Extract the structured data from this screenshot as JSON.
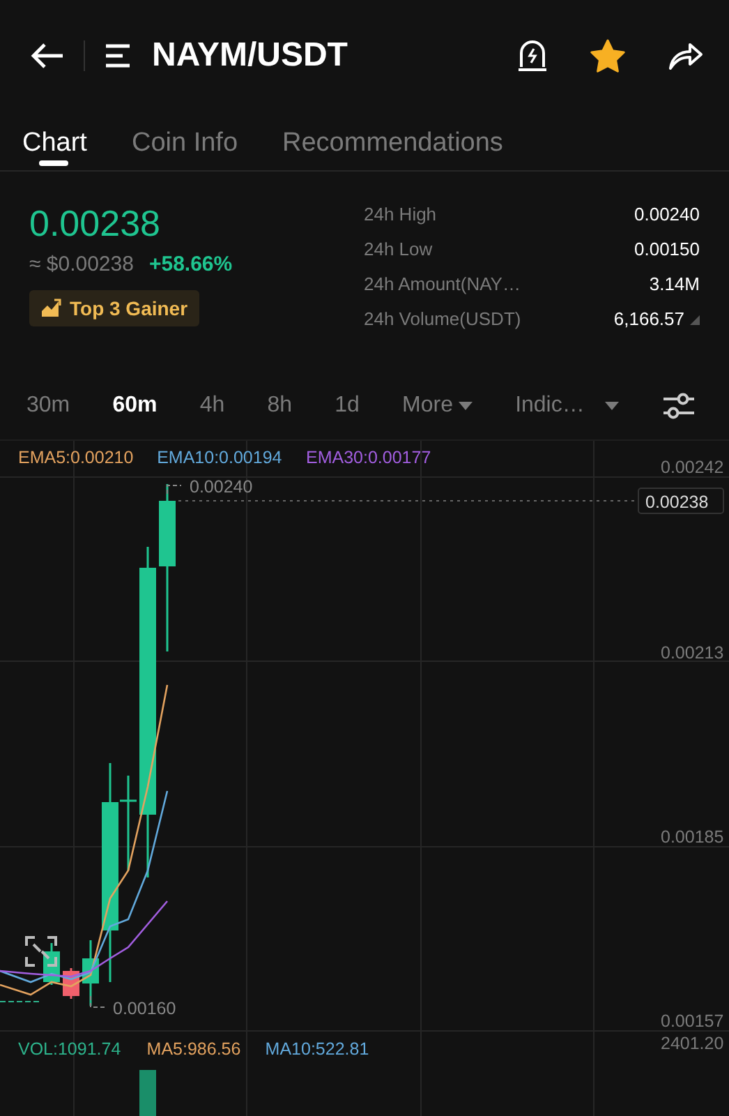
{
  "header": {
    "title": "NAYM/USDT",
    "favorited": true
  },
  "tabs": [
    {
      "label": "Chart",
      "selected": true
    },
    {
      "label": "Coin Info",
      "selected": false
    },
    {
      "label": "Recommendations",
      "selected": false
    }
  ],
  "price": {
    "last": "0.00238",
    "fiat": "≈ $0.00238",
    "change": "+58.66%",
    "badge": "Top 3 Gainer"
  },
  "stats": [
    {
      "label": "24h High",
      "value": "0.00240"
    },
    {
      "label": "24h Low",
      "value": "0.00150"
    },
    {
      "label": "24h Amount(NAY…",
      "value": "3.14M"
    },
    {
      "label": "24h Volume(USDT)",
      "value": "6,166.57"
    }
  ],
  "intervals": [
    {
      "label": "30m",
      "kind": "option",
      "selected": false
    },
    {
      "label": "60m",
      "kind": "option",
      "selected": true
    },
    {
      "label": "4h",
      "kind": "option",
      "selected": false
    },
    {
      "label": "8h",
      "kind": "option",
      "selected": false
    },
    {
      "label": "1d",
      "kind": "option",
      "selected": false
    },
    {
      "label": "More",
      "kind": "dropdown",
      "selected": false
    },
    {
      "label": "Indic…",
      "kind": "dropdown",
      "selected": false
    }
  ],
  "chart": {
    "legend": [
      {
        "text": "EMA5:0.00210",
        "color": "#e3a25f"
      },
      {
        "text": "EMA10:0.00194",
        "color": "#62a9dc"
      },
      {
        "text": "EMA30:0.00177",
        "color": "#a25ee0"
      }
    ],
    "price_ticks": [
      "0.00242",
      "0.00213",
      "0.00185",
      "0.00157"
    ],
    "last_price": "0.00238",
    "high_marker": "0.00240",
    "low_marker": "0.00160",
    "volume_legend": [
      {
        "text": "VOL:1091.74",
        "color": "#2db48c"
      },
      {
        "text": "MA5:986.56",
        "color": "#e3a25f"
      },
      {
        "text": "MA10:522.81",
        "color": "#62a9dc"
      }
    ],
    "volume_tick": "2401.20"
  }
}
